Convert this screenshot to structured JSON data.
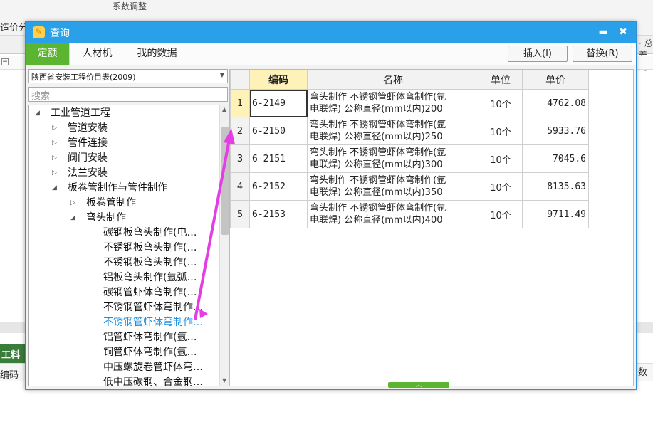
{
  "background": {
    "left_label": "造价分",
    "top_fragment": "系数调整",
    "top_right_fragment": "· 总",
    "right_fragment": "差别",
    "bottom_left_tab": "工料机",
    "bottom_label": "编码",
    "bottom_right": "数"
  },
  "dialog": {
    "title": "查询",
    "minimize_glyph": "▬",
    "close_glyph": "✖"
  },
  "tabs": [
    {
      "label": "定额",
      "active": true
    },
    {
      "label": "人材机",
      "active": false
    },
    {
      "label": "我的数据",
      "active": false
    }
  ],
  "toolbar": {
    "insert_label": "插入(I)",
    "replace_label": "替换(R)"
  },
  "left": {
    "catalog_selected": "陕西省安装工程价目表(2009)",
    "search_placeholder": "搜索"
  },
  "tree": [
    {
      "label": "工业管道工程",
      "level": 0,
      "state": "open"
    },
    {
      "label": "管道安装",
      "level": 1,
      "state": "closed"
    },
    {
      "label": "管件连接",
      "level": 1,
      "state": "closed"
    },
    {
      "label": "阀门安装",
      "level": 1,
      "state": "closed"
    },
    {
      "label": "法兰安装",
      "level": 1,
      "state": "closed"
    },
    {
      "label": "板卷管制作与管件制作",
      "level": 1,
      "state": "open"
    },
    {
      "label": "板卷管制作",
      "level": 2,
      "state": "closed"
    },
    {
      "label": "弯头制作",
      "level": 2,
      "state": "open"
    },
    {
      "label": "碳钢板弯头制作(电…",
      "level": 3,
      "state": "leaf"
    },
    {
      "label": "不锈钢板弯头制作(…",
      "level": 3,
      "state": "leaf"
    },
    {
      "label": "不锈钢板弯头制作(…",
      "level": 3,
      "state": "leaf"
    },
    {
      "label": "铝板弯头制作(氩弧…",
      "level": 3,
      "state": "leaf"
    },
    {
      "label": "碳钢管虾体弯制作(…",
      "level": 3,
      "state": "leaf"
    },
    {
      "label": "不锈钢管虾体弯制作…",
      "level": 3,
      "state": "leaf"
    },
    {
      "label": "不锈钢管虾体弯制作…",
      "level": 3,
      "state": "leaf",
      "selected": true
    },
    {
      "label": "铝管虾体弯制作(氩…",
      "level": 3,
      "state": "leaf"
    },
    {
      "label": "铜管虾体弯制作(氩…",
      "level": 3,
      "state": "leaf"
    },
    {
      "label": "中压螺旋卷管虾体弯…",
      "level": 3,
      "state": "leaf"
    },
    {
      "label": "低中压碳钢、合金钢…",
      "level": 3,
      "state": "leaf"
    }
  ],
  "grid": {
    "headers": {
      "code": "编码",
      "name": "名称",
      "unit": "单位",
      "price": "单价"
    },
    "rows": [
      {
        "n": "1",
        "code": "6-2149",
        "name_line1": "弯头制作 不锈钢管虾体弯制作(氩",
        "name_line2": "电联焊) 公称直径(mm以内)200",
        "unit": "10个",
        "price": "4762.08"
      },
      {
        "n": "2",
        "code": "6-2150",
        "name_line1": "弯头制作 不锈钢管虾体弯制作(氩",
        "name_line2": "电联焊) 公称直径(mm以内)250",
        "unit": "10个",
        "price": "5933.76"
      },
      {
        "n": "3",
        "code": "6-2151",
        "name_line1": "弯头制作 不锈钢管虾体弯制作(氩",
        "name_line2": "电联焊) 公称直径(mm以内)300",
        "unit": "10个",
        "price": "7045.6"
      },
      {
        "n": "4",
        "code": "6-2152",
        "name_line1": "弯头制作 不锈钢管虾体弯制作(氩",
        "name_line2": "电联焊) 公称直径(mm以内)350",
        "unit": "10个",
        "price": "8135.63"
      },
      {
        "n": "5",
        "code": "6-2153",
        "name_line1": "弯头制作 不锈钢管虾体弯制作(氩",
        "name_line2": "电联焊) 公称直径(mm以内)400",
        "unit": "10个",
        "price": "9711.49"
      }
    ]
  },
  "colors": {
    "titlebar": "#29a0e8",
    "active_tab": "#5cb531",
    "selected_tree": "#1e8fe0",
    "annotation_arrow": "#e63ce6"
  }
}
